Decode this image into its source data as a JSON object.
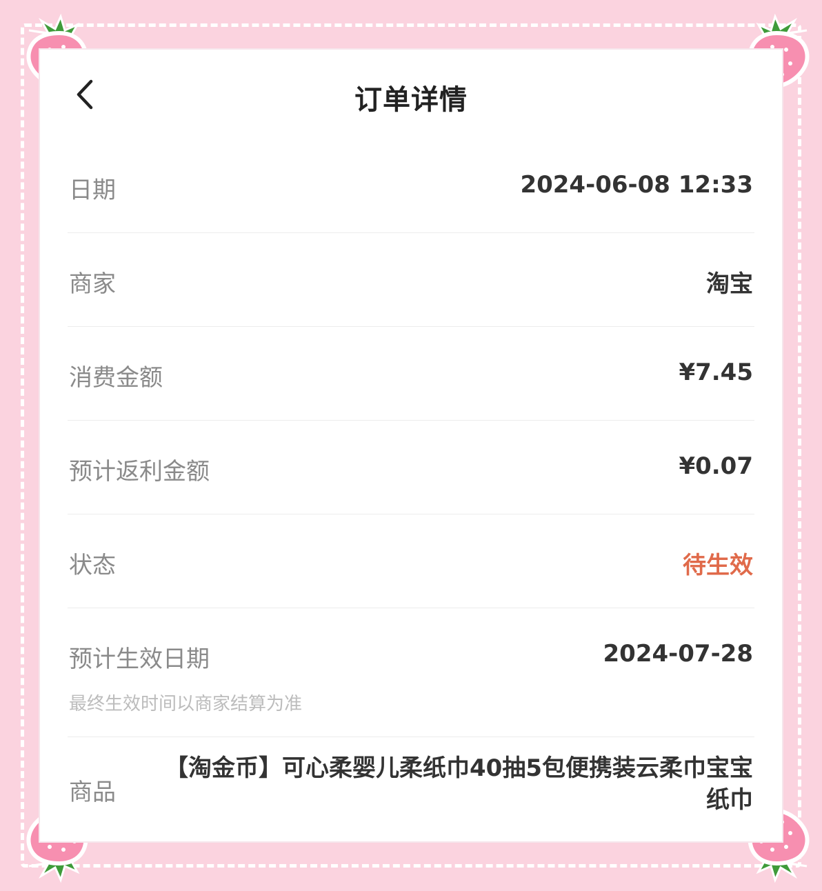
{
  "header": {
    "title": "订单详情"
  },
  "details": {
    "date": {
      "label": "日期",
      "value": "2024-06-08 12:33"
    },
    "merchant": {
      "label": "商家",
      "value": "淘宝"
    },
    "amount": {
      "label": "消费金额",
      "value": "¥7.45"
    },
    "rebate": {
      "label": "预计返利金额",
      "value": "¥0.07"
    },
    "status": {
      "label": "状态",
      "value": "待生效"
    },
    "effective_date": {
      "label": "预计生效日期",
      "value": "2024-07-28",
      "hint": "最终生效时间以商家结算为准"
    },
    "product": {
      "label": "商品",
      "value": "【淘金币】可心柔婴儿柔纸巾40抽5包便携装云柔巾宝宝纸巾"
    }
  },
  "colors": {
    "background_pink": "#fbd3df",
    "status_orange": "#e06a4a"
  }
}
